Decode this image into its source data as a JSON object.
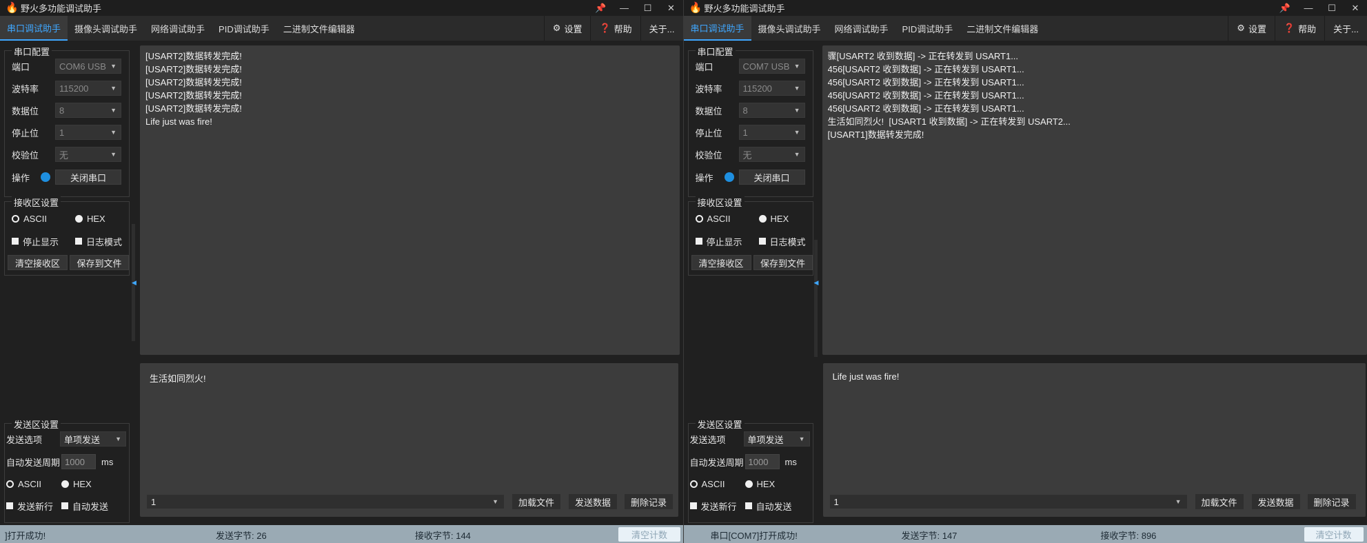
{
  "colors": {
    "accent": "#3fa7ff",
    "indicator": "#1e8fe0",
    "statusbar": "#9aaab4"
  },
  "windows": [
    {
      "title": "野火多功能调试助手",
      "controls": {
        "pin": "📌",
        "help": "?",
        "minimize": "—",
        "maximize": "☐",
        "close": "✕"
      },
      "tabs": [
        "串口调试助手",
        "摄像头调试助手",
        "网络调试助手",
        "PID调试助手",
        "二进制文件编辑器"
      ],
      "right_buttons": {
        "settings": "设置",
        "help": "帮助",
        "about": "关于..."
      },
      "serial": {
        "title": "串口配置",
        "port_label": "端口",
        "port_value": "COM6 USB",
        "baud_label": "波特率",
        "baud_value": "115200",
        "data_label": "数据位",
        "data_value": "8",
        "stop_label": "停止位",
        "stop_value": "1",
        "parity_label": "校验位",
        "parity_value": "无",
        "op_label": "操作",
        "op_button": "关闭串口"
      },
      "receive": {
        "title": "接收区设置",
        "ascii": "ASCII",
        "hex": "HEX",
        "stop_display": "停止显示",
        "log_mode": "日志模式",
        "clear": "清空接收区",
        "save": "保存到文件"
      },
      "send": {
        "title": "发送区设置",
        "option_label": "发送选项",
        "option_value": "单项发送",
        "period_label": "自动发送周期",
        "period_value": "1000",
        "period_unit": "ms",
        "ascii": "ASCII",
        "hex": "HEX",
        "newline": "发送新行",
        "auto_send": "自动发送"
      },
      "recv_text": "[USART2]数据转发完成!\n[USART2]数据转发完成!\n[USART2]数据转发完成!\n[USART2]数据转发完成!\n[USART2]数据转发完成!\nLife just was fire!",
      "send_text": "生活如同烈火!",
      "history_value": "1",
      "send_buttons": {
        "load": "加载文件",
        "send": "发送数据",
        "delete": "删除记录"
      },
      "status": {
        "open": "]打开成功!",
        "sent": "发送字节: 26",
        "recv": "接收字节: 144",
        "clear": "清空计数"
      }
    },
    {
      "title": "野火多功能调试助手",
      "controls": {
        "pin": "📌",
        "help": "?",
        "minimize": "—",
        "maximize": "☐",
        "close": "✕"
      },
      "tabs": [
        "串口调试助手",
        "摄像头调试助手",
        "网络调试助手",
        "PID调试助手",
        "二进制文件编辑器"
      ],
      "right_buttons": {
        "settings": "设置",
        "help": "帮助",
        "about": "关于..."
      },
      "serial": {
        "title": "串口配置",
        "port_label": "端口",
        "port_value": "COM7 USB",
        "baud_label": "波特率",
        "baud_value": "115200",
        "data_label": "数据位",
        "data_value": "8",
        "stop_label": "停止位",
        "stop_value": "1",
        "parity_label": "校验位",
        "parity_value": "无",
        "op_label": "操作",
        "op_button": "关闭串口"
      },
      "receive": {
        "title": "接收区设置",
        "ascii": "ASCII",
        "hex": "HEX",
        "stop_display": "停止显示",
        "log_mode": "日志模式",
        "clear": "清空接收区",
        "save": "保存到文件"
      },
      "send": {
        "title": "发送区设置",
        "option_label": "发送选项",
        "option_value": "单项发送",
        "period_label": "自动发送周期",
        "period_value": "1000",
        "period_unit": "ms",
        "ascii": "ASCII",
        "hex": "HEX",
        "newline": "发送新行",
        "auto_send": "自动发送"
      },
      "recv_text": "骤[USART2 收到数据] -> 正在转发到 USART1...\n456[USART2 收到数据] -> 正在转发到 USART1...\n456[USART2 收到数据] -> 正在转发到 USART1...\n456[USART2 收到数据] -> 正在转发到 USART1...\n456[USART2 收到数据] -> 正在转发到 USART1...\n生活如同烈火!  [USART1 收到数据] -> 正在转发到 USART2...\n[USART1]数据转发完成!",
      "send_text": "Life just was fire!",
      "history_value": "1",
      "send_buttons": {
        "load": "加载文件",
        "send": "发送数据",
        "delete": "删除记录"
      },
      "status": {
        "open": "串口[COM7]打开成功!",
        "sent": "发送字节: 147",
        "recv": "接收字节: 896",
        "clear": "清空计数"
      }
    }
  ]
}
